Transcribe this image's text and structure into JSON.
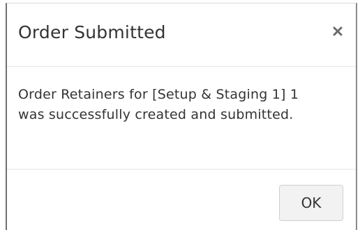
{
  "dialog": {
    "title": "Order Submitted",
    "close_icon": "close-icon",
    "message": "Order Retainers for [Setup & Staging 1] 1 was successfully created and submitted.",
    "ok_label": "OK"
  }
}
